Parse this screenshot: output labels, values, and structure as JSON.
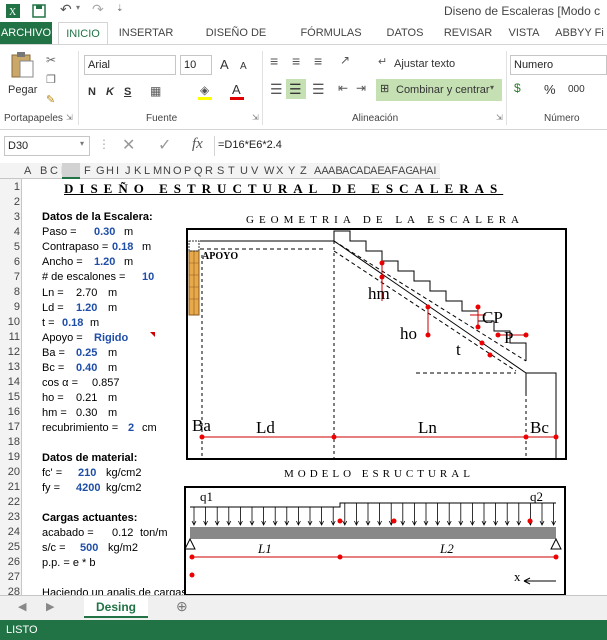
{
  "window": {
    "title": "Diseno de Escaleras  [Modo c"
  },
  "tabs": {
    "file": "ARCHIVO",
    "home": "INICIO",
    "insert": "INSERTAR",
    "layout": "DISEÑO DE PÁGINA",
    "formulas": "FÓRMULAS",
    "data": "DATOS",
    "review": "REVISAR",
    "view": "VISTA",
    "abbyy": "ABBYY Fi"
  },
  "ribbon": {
    "paste": "Pegar",
    "clipboard": "Portapapeles",
    "font_name": "Arial",
    "font_size": "10",
    "grow": "A",
    "shrink": "A",
    "bold": "N",
    "italic": "K",
    "underline": "S",
    "font_group": "Fuente",
    "wrap": "Ajustar texto",
    "merge": "Combinar y centrar",
    "align_group": "Alineación",
    "number_format": "Numero",
    "percent": "%",
    "thousands": "000",
    "number_group": "Número"
  },
  "formula": {
    "name_box": "D30",
    "fx": "fx",
    "content": "=D16*E6*2.4"
  },
  "columns": [
    "A",
    "B",
    "C",
    "D",
    "E",
    "F",
    "G",
    "H",
    "I",
    "J",
    "K",
    "L",
    "M",
    "N",
    "O",
    "P",
    "Q",
    "R",
    "S",
    "T",
    "U",
    "V",
    "W",
    "X",
    "Y",
    "Z",
    "AA",
    "AB",
    "AC",
    "AD",
    "AE",
    "AF",
    "AG",
    "AH",
    "AI"
  ],
  "rows": [
    "1",
    "2",
    "3",
    "4",
    "5",
    "6",
    "7",
    "8",
    "9",
    "10",
    "11",
    "12",
    "13",
    "14",
    "15",
    "16",
    "17",
    "18",
    "19",
    "20",
    "21",
    "22",
    "23",
    "24",
    "25",
    "26",
    "27",
    "28"
  ],
  "sheet": {
    "title": "DISEÑO   ESTRUCTURAL   DE   ESCALERAS",
    "sec1": "Datos de la Escalera:",
    "paso_l": "Paso =",
    "paso_v": "0.30",
    "paso_u": "m",
    "cp_l": "Contrapaso =",
    "cp_v": "0.18",
    "cp_u": "m",
    "ancho_l": "Ancho =",
    "ancho_v": "1.20",
    "ancho_u": "m",
    "nesc_l": "# de escalones =",
    "nesc_v": "10",
    "ln_l": "Ln =",
    "ln_v": "2.70",
    "ln_u": "m",
    "ld_l": "Ld =",
    "ld_v": "1.20",
    "ld_u": "m",
    "t_l": "t =",
    "t_v": "0.18",
    "t_u": "m",
    "apoyo_l": "Apoyo =",
    "apoyo_v": "Rigido",
    "ba_l": "Ba =",
    "ba_v": "0.25",
    "ba_u": "m",
    "bc_l": "Bc =",
    "bc_v": "0.40",
    "bc_u": "m",
    "cos_l": "cos α =",
    "cos_v": "0.857",
    "ho_l": "ho =",
    "ho_v": "0.21",
    "ho_u": "m",
    "hm_l": "hm =",
    "hm_v": "0.30",
    "hm_u": "m",
    "rec_l": "recubrimiento =",
    "rec_v": "2",
    "rec_u": "cm",
    "sec2": "Datos de material:",
    "fc_l": "fc' =",
    "fc_v": "210",
    "fc_u": "kg/cm2",
    "fy_l": "fy =",
    "fy_v": "4200",
    "fy_u": "kg/cm2",
    "sec3": "Cargas actuantes:",
    "acab_l": "acabado =",
    "acab_v": "0.12",
    "acab_u": "ton/m",
    "sc_l": "s/c =",
    "sc_v": "500",
    "sc_u": "kg/m2",
    "pp_l": "p.p. = e * b",
    "note": "Haciendo un analis de cargas tenemos:"
  },
  "geometry": {
    "heading": "GEOMETRIA  DE  LA  ESCALERA",
    "apoyo": "APOYO",
    "hm": "hm",
    "ho": "ho",
    "t": "t",
    "cp": "CP",
    "p": "P",
    "ba": "Ba",
    "ld": "Ld",
    "ln": "Ln",
    "bc": "Bc"
  },
  "model": {
    "heading": "MODELO  ESRUCTURAL",
    "q1": "q1",
    "q2": "q2",
    "l1": "L1",
    "l2": "L2",
    "x": "x"
  },
  "sheet_tab": "Desing",
  "status": "LISTO"
}
